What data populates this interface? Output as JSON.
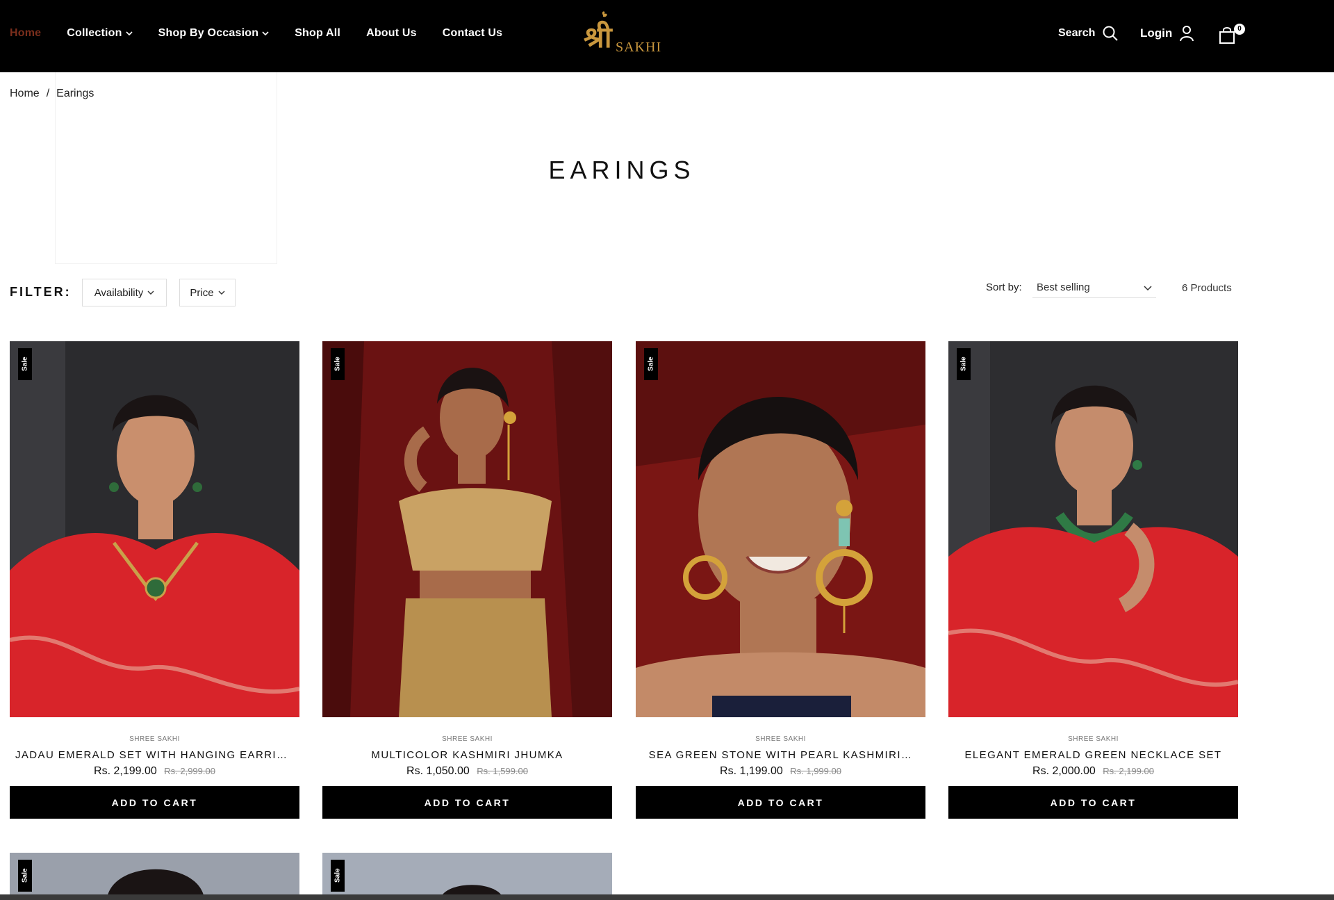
{
  "header": {
    "nav": [
      {
        "label": "Home",
        "active": true,
        "dropdown": false
      },
      {
        "label": "Collection",
        "active": false,
        "dropdown": true
      },
      {
        "label": "Shop By Occasion",
        "active": false,
        "dropdown": true
      },
      {
        "label": "Shop All",
        "active": false,
        "dropdown": false
      },
      {
        "label": "About Us",
        "active": false,
        "dropdown": false
      },
      {
        "label": "Contact Us",
        "active": false,
        "dropdown": false
      }
    ],
    "logo": {
      "devanagari": "श्री",
      "latin": "SAKHI"
    },
    "search_label": "Search",
    "login_label": "Login",
    "cart_count": "0",
    "colors": {
      "background": "#000000",
      "active_nav": "#7a2e1c",
      "logo_gold": "#c9973e"
    }
  },
  "breadcrumb": {
    "home": "Home",
    "separator": "/",
    "current": "Earings"
  },
  "page_title": "EARINGS",
  "filter": {
    "label": "FILTER:",
    "buttons": [
      "Availability",
      "Price"
    ]
  },
  "sort": {
    "label": "Sort by:",
    "value": "Best selling"
  },
  "product_count": "6 Products",
  "products": [
    {
      "vendor": "SHREE SAKHI",
      "name": "JADAU EMERALD SET WITH HANGING EARRINGS",
      "price": "Rs. 2,199.00",
      "compare_price": "Rs. 2,999.00",
      "badge": "Sale",
      "button": "ADD TO CART"
    },
    {
      "vendor": "SHREE SAKHI",
      "name": "MULTICOLOR KASHMIRI JHUMKA",
      "price": "Rs. 1,050.00",
      "compare_price": "Rs. 1,599.00",
      "badge": "Sale",
      "button": "ADD TO CART"
    },
    {
      "vendor": "SHREE SAKHI",
      "name": "SEA GREEN STONE WITH PEARL KASHMIRI…",
      "price": "Rs. 1,199.00",
      "compare_price": "Rs. 1,999.00",
      "badge": "Sale",
      "button": "ADD TO CART"
    },
    {
      "vendor": "SHREE SAKHI",
      "name": "ELEGANT EMERALD GREEN NECKLACE SET",
      "price": "Rs. 2,000.00",
      "compare_price": "Rs. 2,199.00",
      "badge": "Sale",
      "button": "ADD TO CART"
    }
  ],
  "partial_products": [
    {
      "badge": "Sale"
    },
    {
      "badge": "Sale"
    }
  ]
}
